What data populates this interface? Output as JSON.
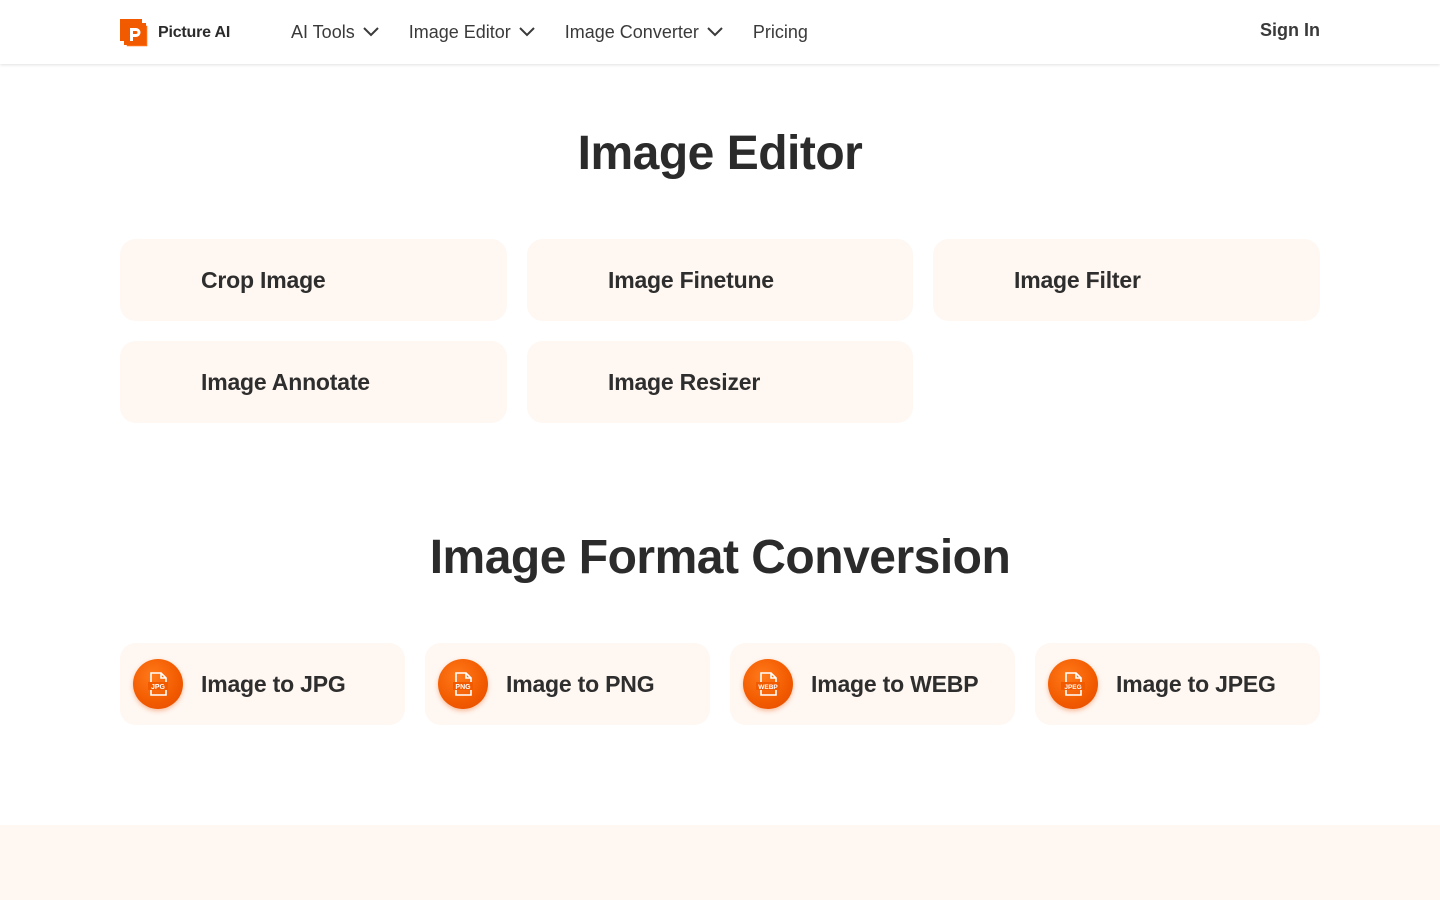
{
  "header": {
    "brand_name": "Picture AI",
    "nav": [
      {
        "label": "AI Tools",
        "has_dropdown": true
      },
      {
        "label": "Image Editor",
        "has_dropdown": true
      },
      {
        "label": "Image Converter",
        "has_dropdown": true
      },
      {
        "label": "Pricing",
        "has_dropdown": false
      }
    ],
    "sign_in_label": "Sign In"
  },
  "image_editor": {
    "title": "Image Editor",
    "tools": [
      {
        "label": "Crop Image"
      },
      {
        "label": "Image Finetune"
      },
      {
        "label": "Image Filter"
      },
      {
        "label": "Image Annotate"
      },
      {
        "label": "Image Resizer"
      }
    ]
  },
  "format_conversion": {
    "title": "Image Format Conversion",
    "tools": [
      {
        "label": "Image to JPG",
        "icon": "jpg-file-icon",
        "badge": "JPG"
      },
      {
        "label": "Image to PNG",
        "icon": "png-file-icon",
        "badge": "PNG"
      },
      {
        "label": "Image to WEBP",
        "icon": "webp-file-icon",
        "badge": "WEBP"
      },
      {
        "label": "Image to JPEG",
        "icon": "jpeg-file-icon",
        "badge": "JPEG"
      }
    ]
  },
  "colors": {
    "accent": "#f25a00",
    "card_bg": "#fff7f1",
    "text": "#2b2b2b"
  }
}
